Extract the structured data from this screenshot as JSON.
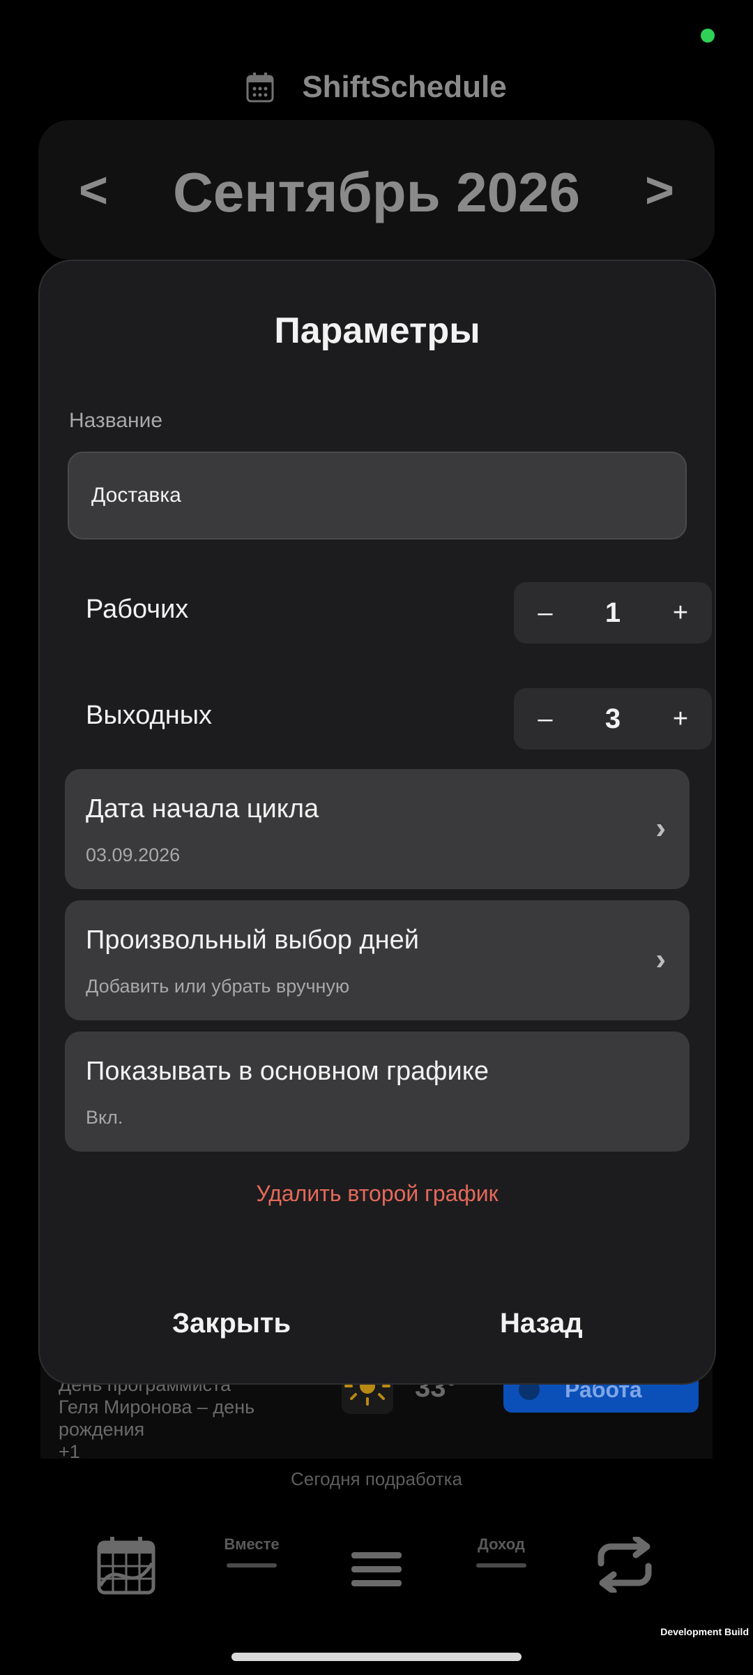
{
  "app": {
    "title": "ShiftSchedule"
  },
  "month_nav": {
    "month": "Сентябрь 2026",
    "prev": "<",
    "next": ">"
  },
  "background": {
    "event_lines": [
      "День программиста",
      "Геля Миронова – день",
      "рождения",
      "+1"
    ],
    "weather_temp": "33°",
    "work_button": "Работа",
    "footer_note": "Сегодня подработка"
  },
  "modal": {
    "title": "Параметры",
    "name_label": "Название",
    "name_value": "Доставка",
    "work_days": {
      "label": "Рабочих",
      "minus": "–",
      "value": "1",
      "plus": "+"
    },
    "off_days": {
      "label": "Выходных",
      "minus": "–",
      "value": "3",
      "plus": "+"
    },
    "options": [
      {
        "title": "Дата начала цикла",
        "subtitle": "03.09.2026",
        "chevron": "›"
      },
      {
        "title": "Произвольный выбор дней",
        "subtitle": "Добавить или убрать вручную",
        "chevron": "›"
      },
      {
        "title": "Показывать в основном графике",
        "subtitle": "Вкл."
      }
    ],
    "delete_label": "Удалить второй график",
    "close_label": "Закрыть",
    "back_label": "Назад"
  },
  "bottom_nav": {
    "together": "Вместе",
    "income": "Доход"
  },
  "dev_build": "Development Build",
  "colors": {
    "accent_blue": "#0b4fb8",
    "danger": "#e5695a",
    "modal_bg": "#1c1c1e",
    "card_bg": "#3a3a3c",
    "status_green": "#30d158"
  }
}
